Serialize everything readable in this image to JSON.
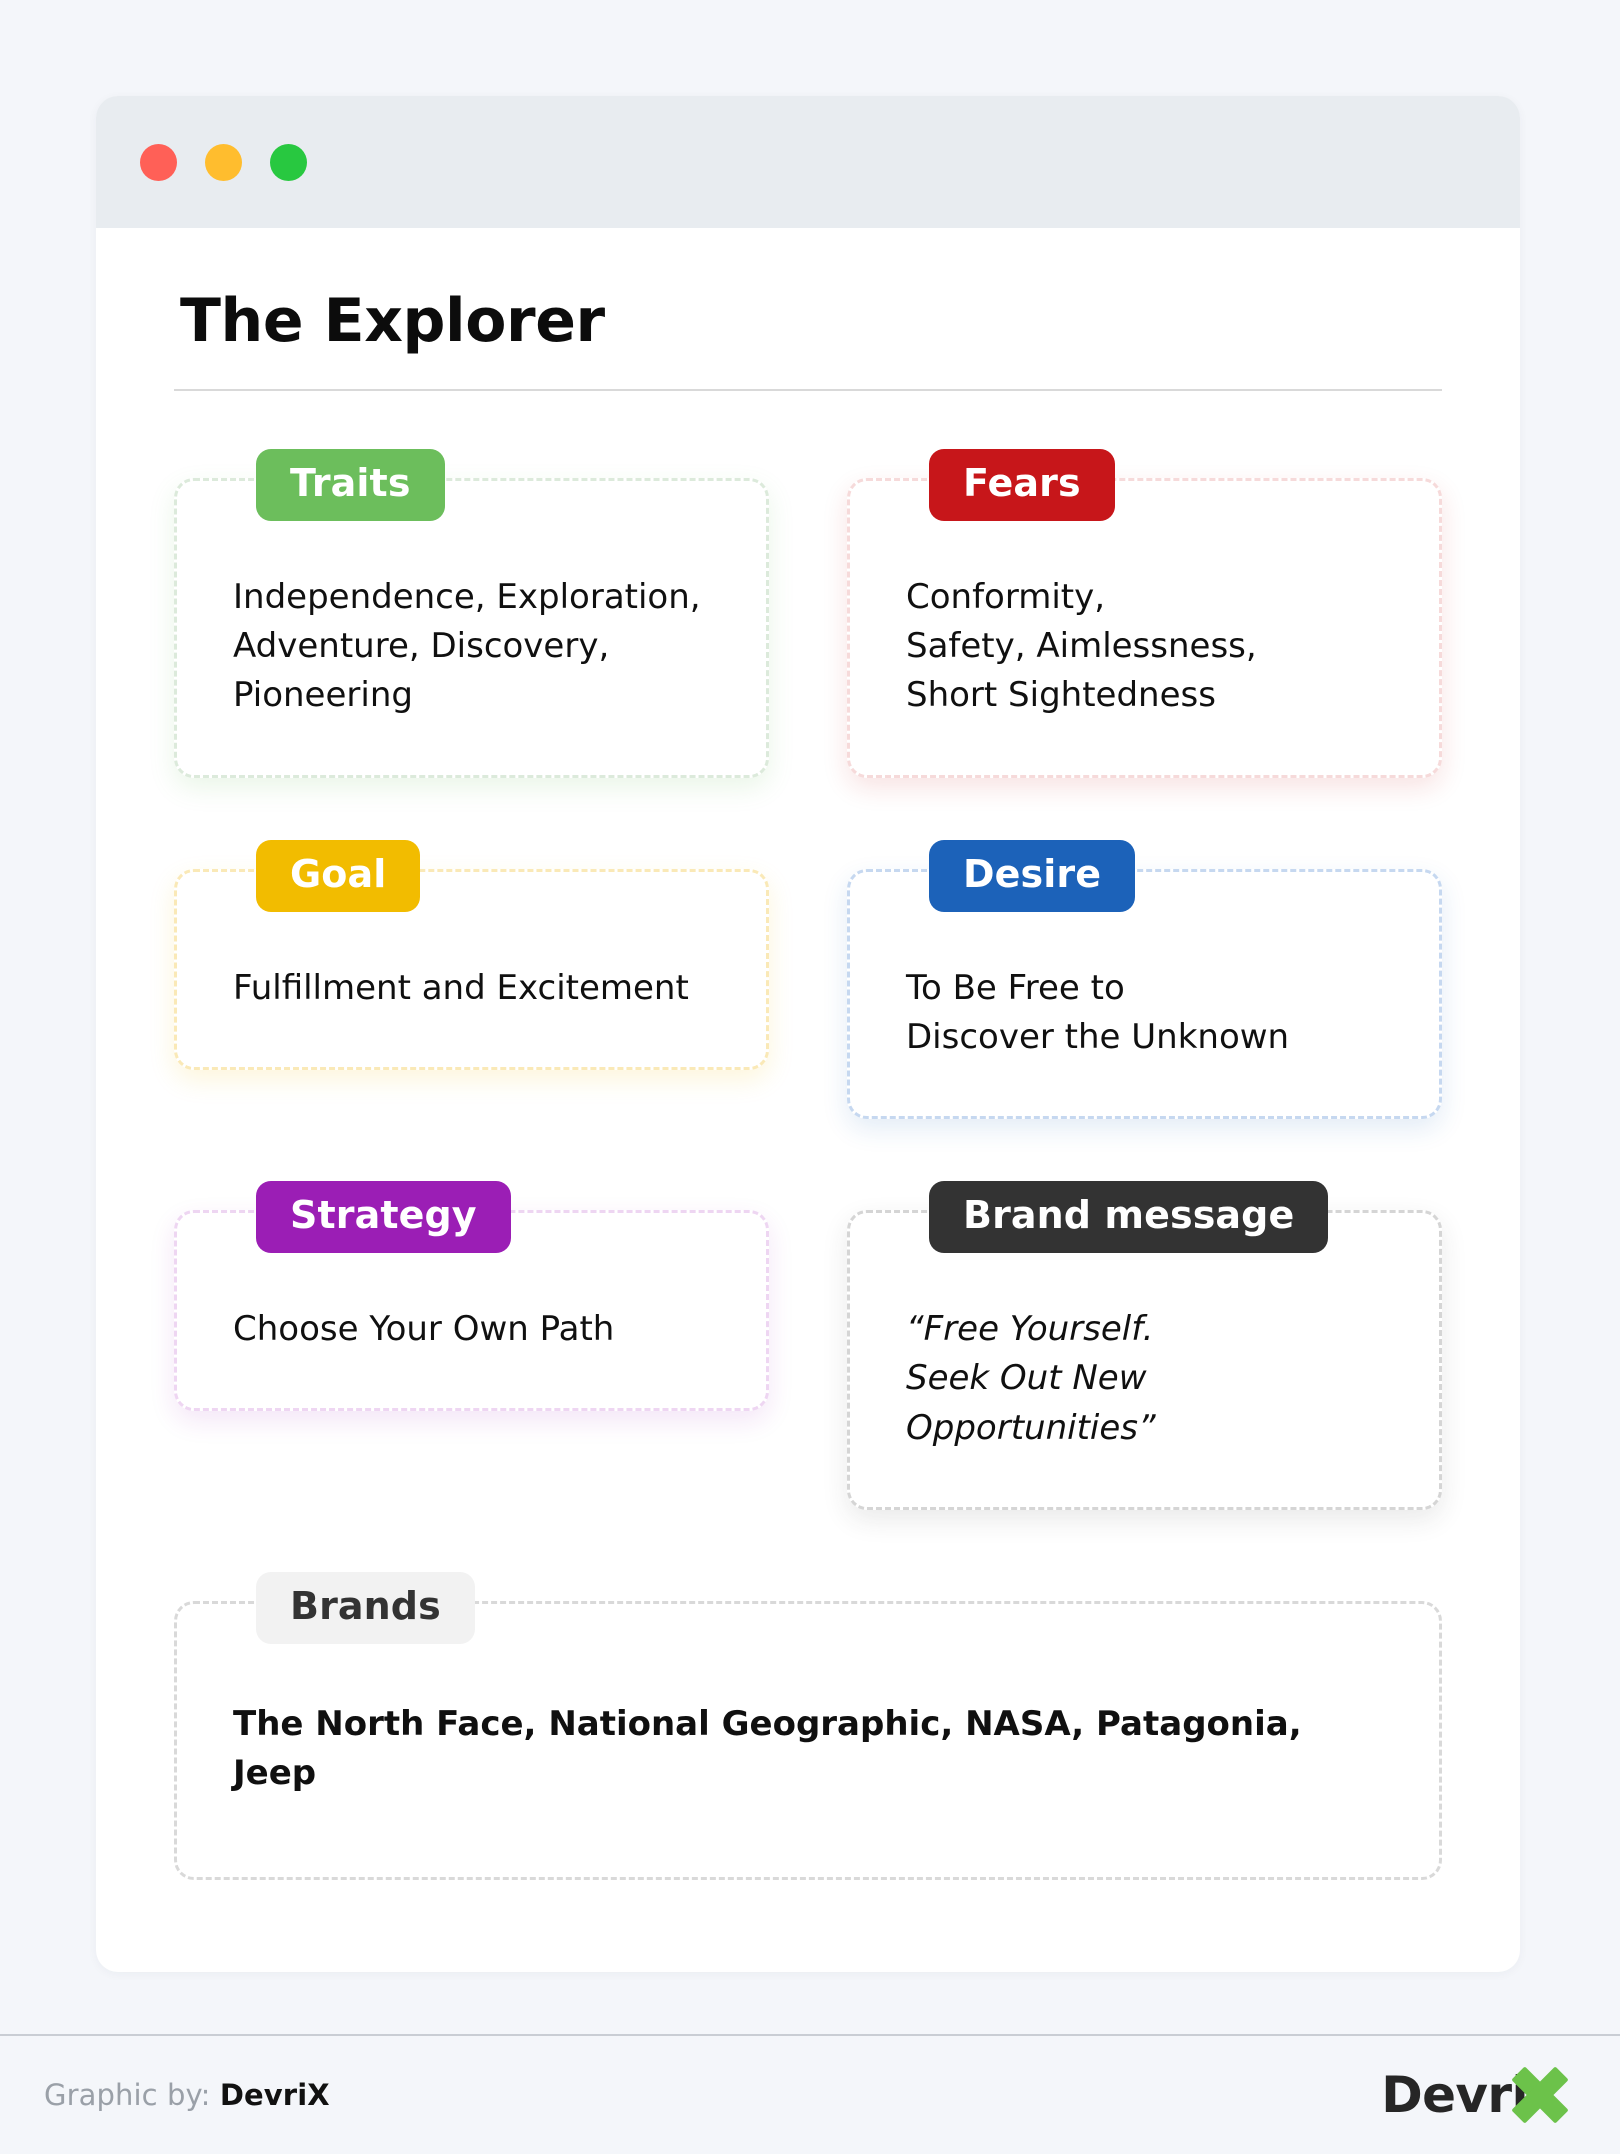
{
  "window": {
    "dots": [
      {
        "name": "close-dot",
        "color": "#ff6057"
      },
      {
        "name": "minimize-dot",
        "color": "#ffbd2e"
      },
      {
        "name": "maximize-dot",
        "color": "#28c840"
      }
    ]
  },
  "heading": {
    "title": "The Explorer"
  },
  "cards": [
    {
      "key": "traits",
      "label": "Traits",
      "badge_color": "#6cbe5c",
      "body": "Independence, Exploration,\nAdventure, Discovery,\nPioneering",
      "style": "normal"
    },
    {
      "key": "fears",
      "label": "Fears",
      "badge_color": "#c7161a",
      "body": "Conformity,\nSafety, Aimlessness,\nShort Sightedness",
      "style": "normal"
    },
    {
      "key": "goal",
      "label": "Goal",
      "badge_color": "#f2bc00",
      "body": "Fulfillment and Excitement",
      "style": "normal"
    },
    {
      "key": "desire",
      "label": "Desire",
      "badge_color": "#1c62b9",
      "body": "To Be Free to\nDiscover the Unknown",
      "style": "normal"
    },
    {
      "key": "strategy",
      "label": "Strategy",
      "badge_color": "#9b1eb5",
      "body": "Choose Your Own Path",
      "style": "normal"
    },
    {
      "key": "brand-message",
      "label": "Brand message",
      "badge_color": "#333333",
      "body": "“Free Yourself.\nSeek Out New Opportunities”",
      "style": "italic"
    },
    {
      "key": "brands",
      "label": "Brands",
      "badge_color": "#f2f2f2",
      "badge_text_color": "#333333",
      "body": "The North Face, National Geographic, NASA, Patagonia, Jeep",
      "style": "bold"
    }
  ],
  "footer": {
    "credit_prefix": "Graphic by:",
    "credit_brand": "DevriX",
    "logo_text": "Devri",
    "logo_accent_color": "#6cc24a"
  }
}
